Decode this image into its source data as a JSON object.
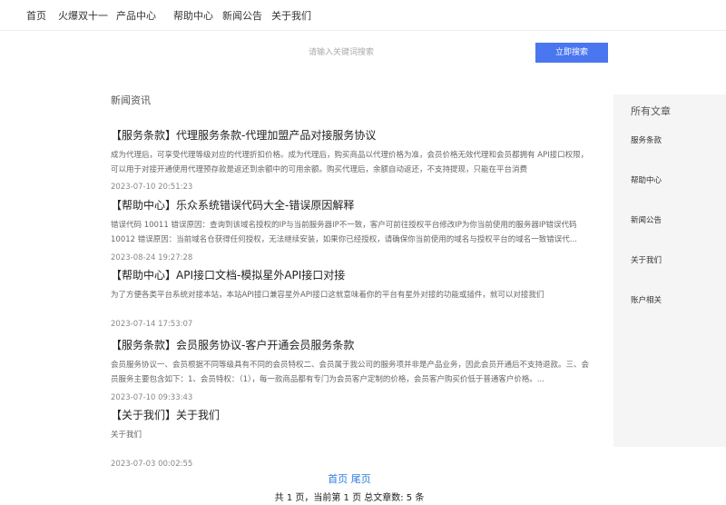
{
  "nav": {
    "items": [
      "首页",
      "火爆双十一",
      "产品中心",
      "帮助中心",
      "新闻公告",
      "关于我们"
    ]
  },
  "search": {
    "placeholder": "请输入关键词搜索",
    "button_label": "立即搜索"
  },
  "section_title": "新闻资讯",
  "articles": [
    {
      "title": "【服务条款】代理服务条款-代理加盟产品对接服务协议",
      "summary": "成为代理后，可享受代理等级对应的代理折扣价格。成为代理后，购买商品以代理价格为准，会员价格无效代理和会员都拥有 API接口权限，可以用于对接开通使用代理预存款是返还到余额中的可用余额。购买代理后，余额自动返还，不支持提现，只能在平台消费",
      "date": "2023-07-10 20:51:23"
    },
    {
      "title": "【帮助中心】乐众系统错误代码大全-错误原因解释",
      "summary": "错误代码 10011 错误原因：查询到该域名授权的IP与当前服务器IP不一致，客户可前往授权平台修改IP为你当前使用的服务器IP错误代码 10012 错误原因：当前域名仓获得任何授权，无法继续安装，如果你已经授权，请确保你当前使用的域名与授权平台的域名一致错误代...",
      "date": "2023-08-24 19:27:28"
    },
    {
      "title": "【帮助中心】API接口文档-模拟星外API接口对接",
      "summary": "为了方便各类平台系统对接本站，本站API接口兼容星外API接口这就意味着你的平台有星外对接的功能或插件，就可以对接我们",
      "date": "2023-07-14 17:53:07"
    },
    {
      "title": "【服务条款】会员服务协议-客户开通会员服务条款",
      "summary": "会员服务协议一、会员根据不同等级具有不同的会员特权二、会员属于我公司的服务项并非是产品业务，因此会员开通后不支持退款。三、会员服务主要包含如下：1、会员特权：（1），每一款商品都有专门为会员客户定制的价格，会员客户购买价低于普通客户价格。...",
      "date": "2023-07-10 09:33:43"
    },
    {
      "title": "【关于我们】关于我们",
      "summary": "关于我们",
      "date": "2023-07-03 00:02:55"
    }
  ],
  "sidebar": {
    "heading": "所有文章",
    "links": [
      "服务条款",
      "帮助中心",
      "新闻公告",
      "关于我们",
      "账户相关"
    ]
  },
  "pagination": {
    "first_label": "首页",
    "last_label": "尾页",
    "info": "共 1 页，当前第 1 页  总文章数: 5 条"
  },
  "colors": {
    "accent": "#4a76f0",
    "link": "#2f7de1",
    "sidebar_bg": "#f5f5f5"
  }
}
